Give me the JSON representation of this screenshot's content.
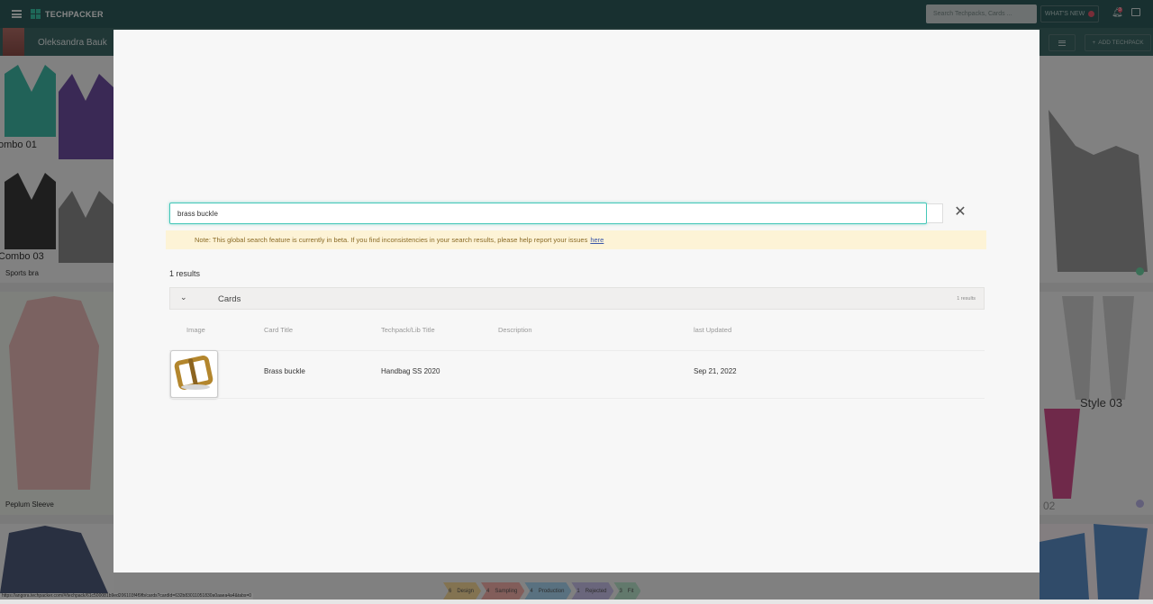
{
  "app": {
    "logo_text": "TECHPACKER",
    "search_placeholder": "Search Techpacks, Cards ...",
    "whats_new_label": "WHAT'S NEW",
    "notification_count": "3"
  },
  "subheader": {
    "user_name": "Oleksandra Bauk",
    "add_techpack_label": "ADD TECHPACK"
  },
  "background_cards": [
    {
      "label": "Sports bra",
      "overlay_text_1": "ombo 01",
      "overlay_text_2": "Combo 03"
    },
    {
      "label": "Peplum Sleeve"
    },
    {
      "overlay_text": "Style 03"
    },
    {
      "overlay_text": "e 02"
    }
  ],
  "status_bar": [
    {
      "count": "6",
      "label": "Design",
      "color": "#f7d99a"
    },
    {
      "count": "4",
      "label": "Sampling",
      "color": "#f6b0aa"
    },
    {
      "count": "4",
      "label": "Production",
      "color": "#a8d6f2"
    },
    {
      "count": "1",
      "label": "Rejected",
      "color": "#c9c1ea"
    },
    {
      "count": "3",
      "label": "Fit",
      "color": "#b9e4cc"
    }
  ],
  "url_hint": "https://angora.techpacker.com/#/techpack/61c500081b9ed206103f4f9fb/cards?cardId=632b83011051830a0aaea4a4&tabs=0",
  "search_modal": {
    "query": "brass buckle",
    "beta_note": "Note: This global search feature is currently in beta. If you find inconsistencies in your search results, please help report your issues",
    "beta_link": "here",
    "results_count": "1 results",
    "section": {
      "title": "Cards",
      "count": "1 results",
      "columns": [
        "Image",
        "Card Title",
        "Techpack/Lib Title",
        "Description",
        "last Updated"
      ],
      "rows": [
        {
          "card_title": "Brass buckle",
          "techpack_title": "Handbag SS 2020",
          "description": "",
          "last_updated": "Sep 21, 2022"
        }
      ]
    }
  }
}
